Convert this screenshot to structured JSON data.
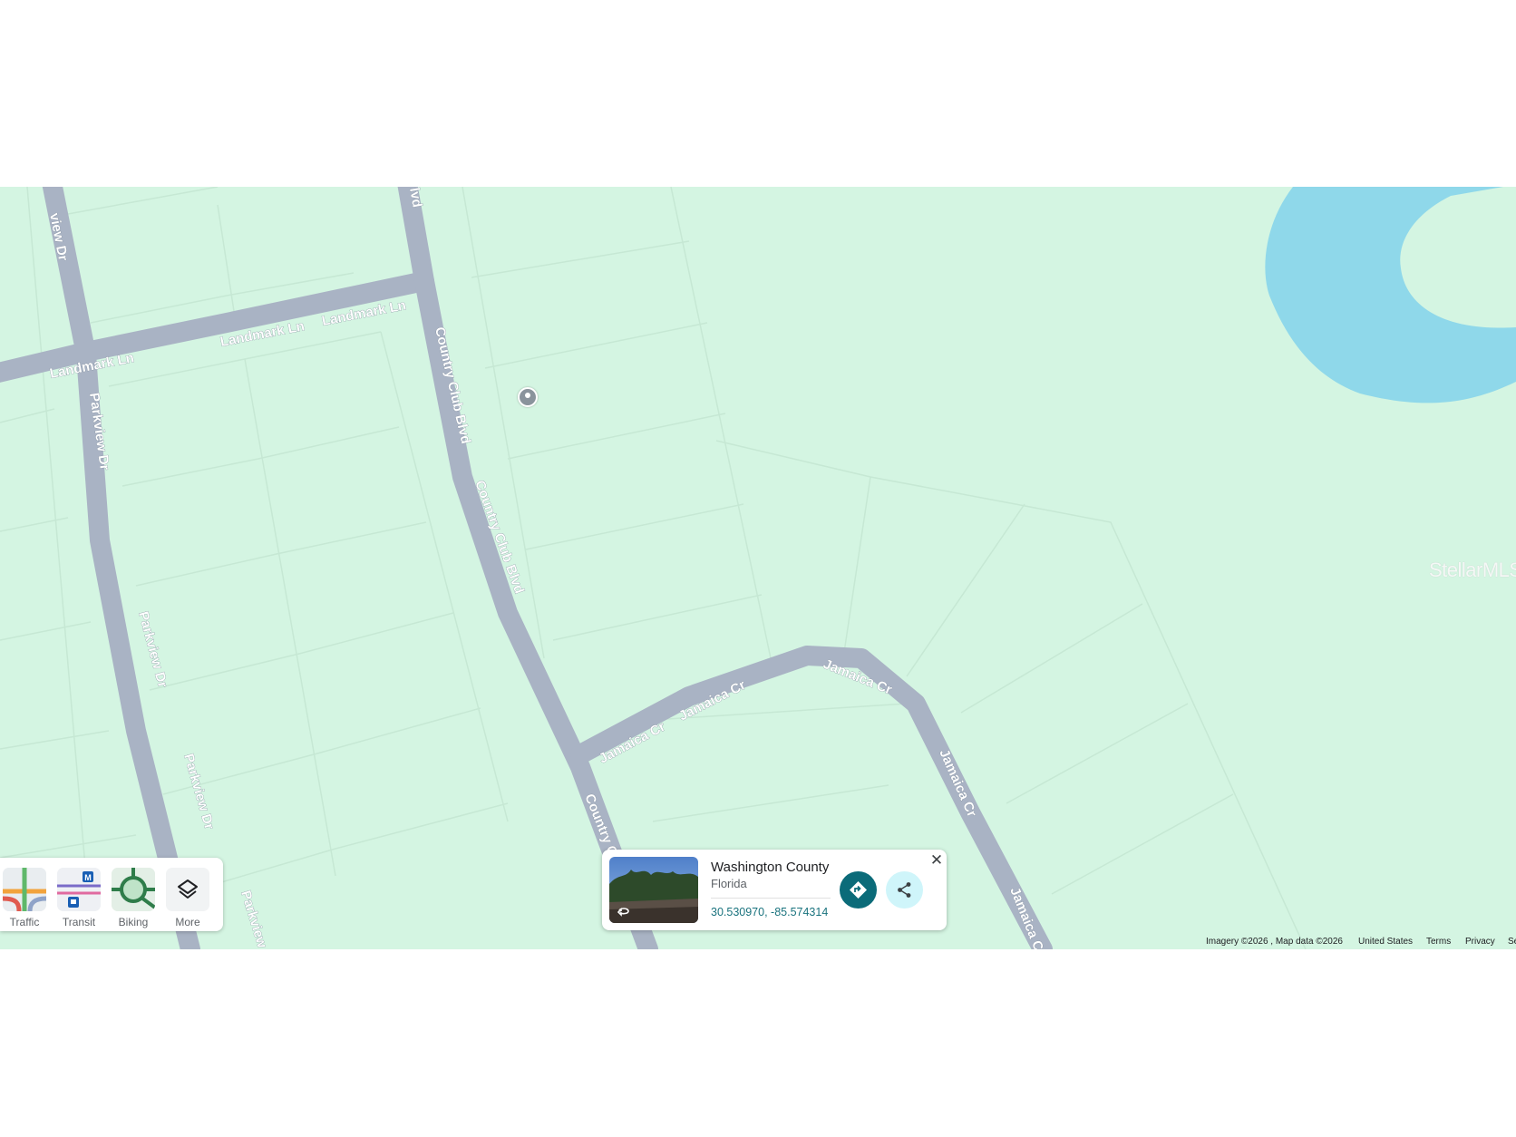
{
  "map": {
    "streets": {
      "parkview_dr": "Parkview Dr",
      "landmark_ln": "Landmark Ln",
      "country_club_blvd": "Country Club Blvd",
      "country_club_blvd_top": "lvd",
      "country_club_blvd_bottom": "Country C",
      "parkview_dr_top": "view Dr",
      "parkview_dr_bottom": "Parkview",
      "jamaica_cr": "Jamaica Cr",
      "jamaica_cr_bottom": "Jamaica C"
    },
    "watermark": "StellarMLS",
    "pin_icon": "map-pin-icon",
    "colors": {
      "land": "#d4f5e2",
      "road": "#a9b3c4",
      "water": "#8fd8ea",
      "parcel_line": "#c6e8d4"
    }
  },
  "layers": [
    {
      "label": "Traffic",
      "icon": "traffic-layer-icon"
    },
    {
      "label": "Transit",
      "icon": "transit-layer-icon"
    },
    {
      "label": "Biking",
      "icon": "biking-layer-icon"
    },
    {
      "label": "More",
      "icon": "layers-icon"
    }
  ],
  "place_card": {
    "title": "Washington County",
    "subtitle": "Florida",
    "coordinates": "30.530970, -85.574314",
    "close_icon": "close-icon",
    "directions_icon": "directions-icon",
    "share_icon": "share-icon",
    "photo_icon": "street-view-icon"
  },
  "footer": {
    "attribution": "Imagery ©2026 , Map data ©2026",
    "region": "United States",
    "terms": "Terms",
    "privacy": "Privacy",
    "send_feedback": "Se"
  }
}
